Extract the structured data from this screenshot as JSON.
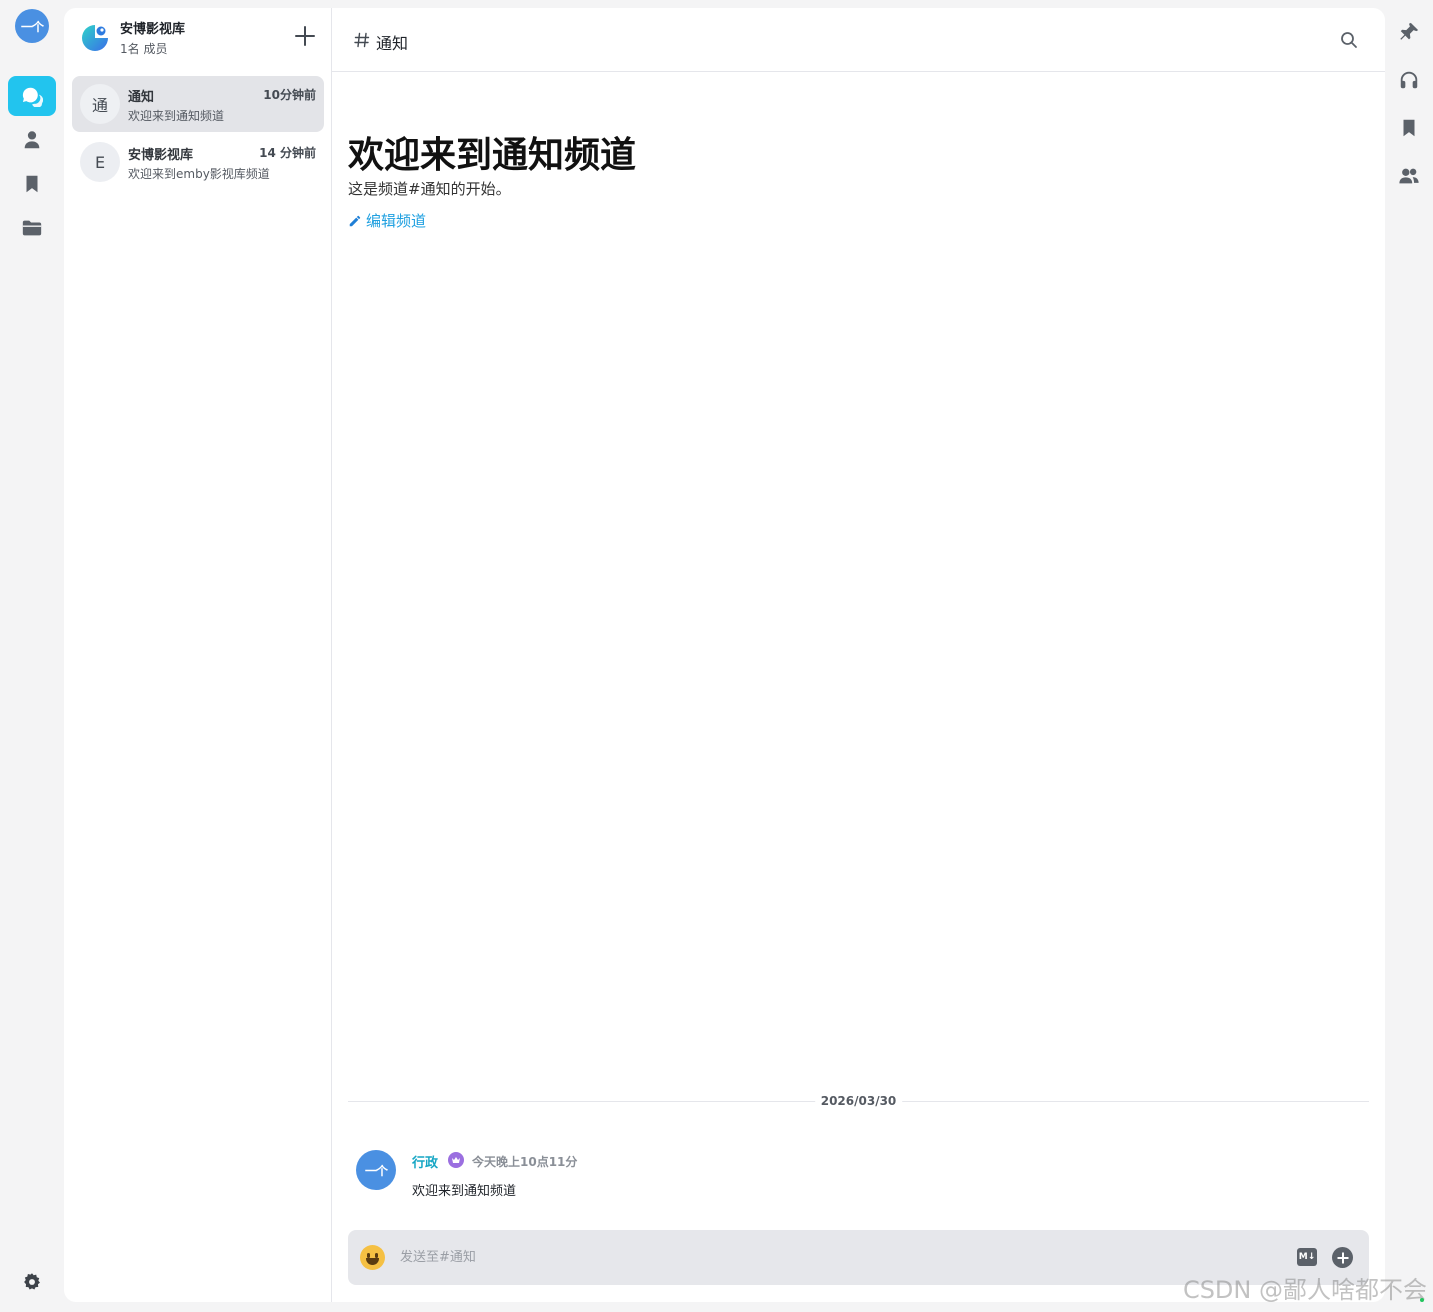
{
  "app": {
    "logo_text": "一个"
  },
  "rail": {
    "items": [
      {
        "icon": "chat-icon",
        "active": true
      },
      {
        "icon": "user-icon",
        "active": false
      },
      {
        "icon": "bookmark-icon",
        "active": false
      },
      {
        "icon": "folder-icon",
        "active": false
      }
    ],
    "settings_icon": "gear-icon"
  },
  "server": {
    "name": "安博影视库",
    "members": "1名 成员"
  },
  "channels": [
    {
      "avatar": "通",
      "name": "通知",
      "time": "10分钟前",
      "preview": "欢迎来到通知频道",
      "active": true
    },
    {
      "avatar": "E",
      "name": "安博影视库",
      "time": "14 分钟前",
      "preview": "欢迎来到emby影视库频道",
      "active": false
    }
  ],
  "main": {
    "title": "通知",
    "welcome_title": "欢迎来到通知频道",
    "welcome_sub": "这是频道#通知的开始。",
    "edit_label": "编辑频道",
    "date_divider": "2026/03/30"
  },
  "message": {
    "avatar": "一个",
    "author": "行政",
    "time": "今天晚上10点11分",
    "text": "欢迎来到通知频道"
  },
  "composer": {
    "placeholder": "发送至#通知",
    "md_label": "M↓"
  },
  "right_rail": {
    "items": [
      "pin-icon",
      "headphones-icon",
      "bookmark-icon",
      "members-icon"
    ]
  },
  "watermark": "CSDN @鄙人啥都不会",
  "colors": {
    "accent": "#22c4ee",
    "author": "#16a6c4",
    "link": "#1fa0e0",
    "avatar_blue": "#4a90e2",
    "crown": "#9b6fe0"
  }
}
